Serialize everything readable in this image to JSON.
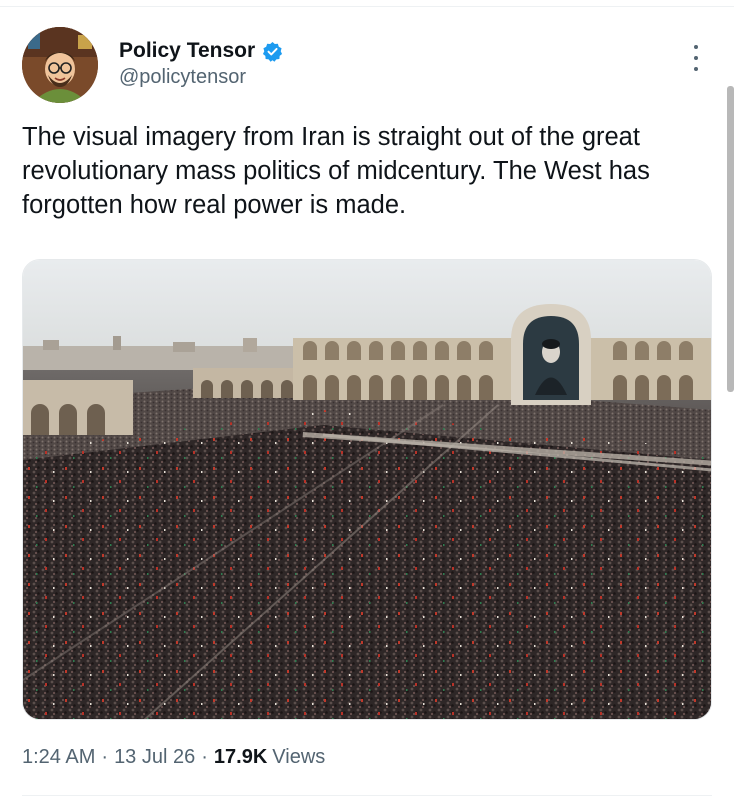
{
  "author": {
    "display_name": "Policy Tensor",
    "handle": "@policytensor",
    "verified": true,
    "avatar_icon": "cartoon-avatar"
  },
  "tweet": {
    "text": "The visual imagery from Iran is straight out of the great revolutionary mass politics of midcentury. The West has forgotten how real power is made."
  },
  "media": {
    "kind": "photo",
    "subject": "mass rally crowd in stadium-like plaza"
  },
  "meta": {
    "time": "1:24 AM",
    "separator": "·",
    "date": "13 Jul 26",
    "views_count": "17.9K",
    "views_label": "Views"
  },
  "colors": {
    "text": "#0f1419",
    "secondary": "#536471",
    "verified_badge": "#1d9bf0"
  }
}
